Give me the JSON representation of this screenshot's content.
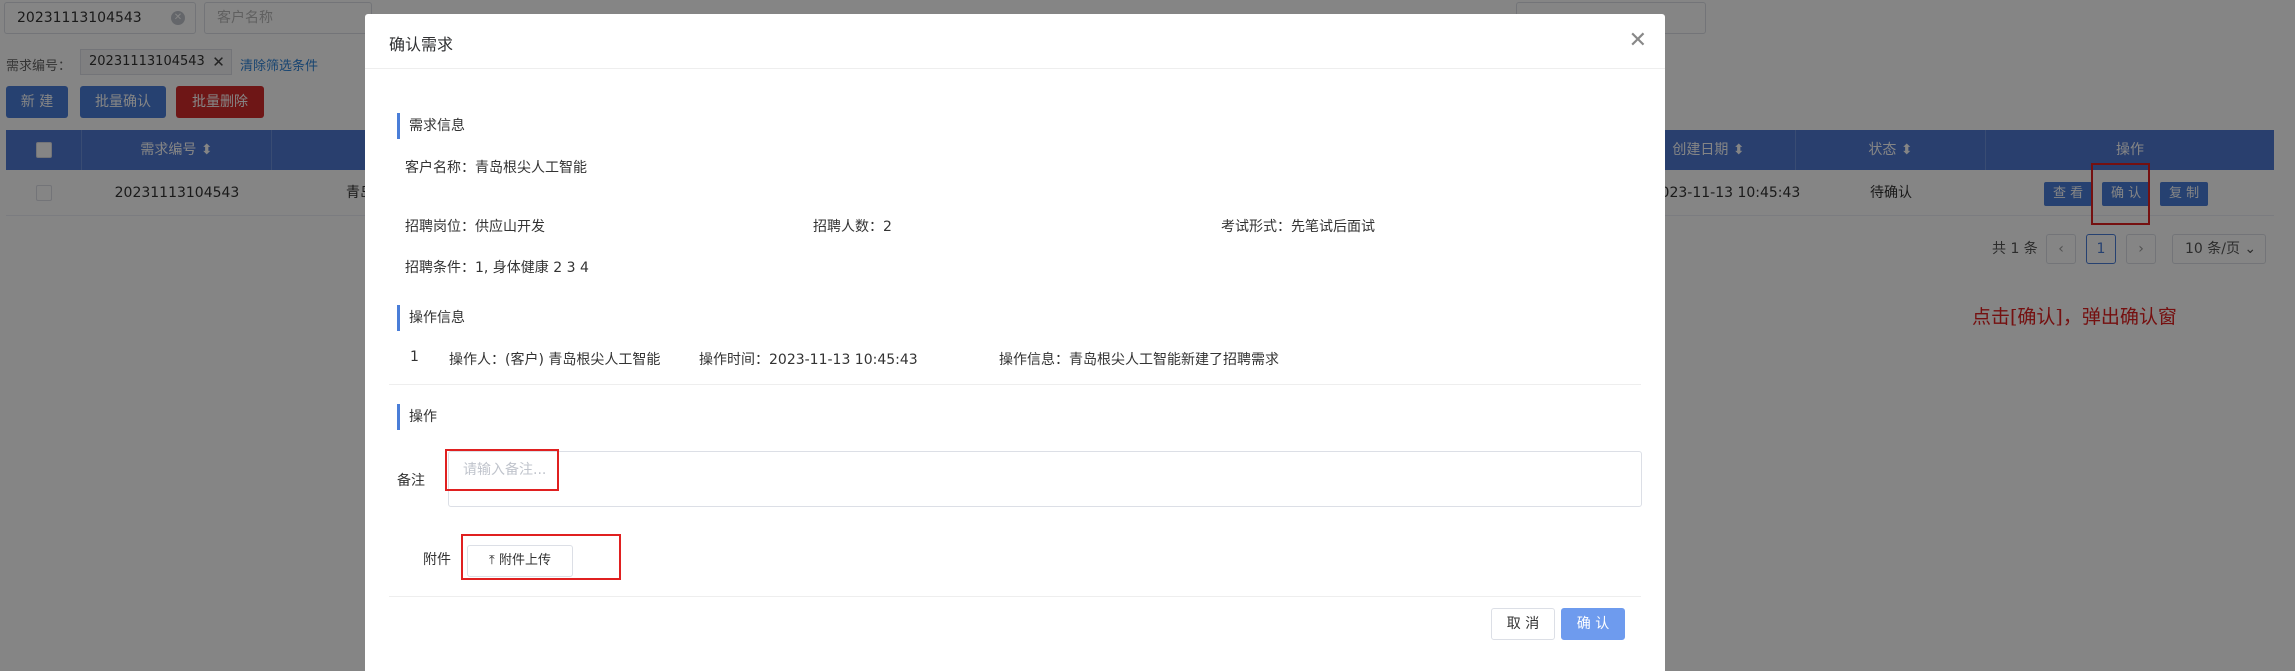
{
  "filters": {
    "req_no_value": "20231113104543",
    "customer_placeholder": "客户名称"
  },
  "conditions": {
    "label": "需求编号：",
    "tag": "20231113104543",
    "tag_close": "✕",
    "clear_link": "清除筛选条件"
  },
  "toolbar": {
    "new_label": "新 建",
    "batch_confirm_label": "批量确认",
    "batch_delete_label": "批量删除"
  },
  "table": {
    "headers": {
      "req_no": "需求编号 ⬍",
      "created": "创建日期 ⬍",
      "status": "状态 ⬍",
      "ops": "操作"
    },
    "row": {
      "req_no": "20231113104543",
      "customer_partial": "青岛",
      "created": "2023-11-13 10:45:43",
      "status": "待确认",
      "view": "查 看",
      "confirm": "确 认",
      "copy": "复 制"
    }
  },
  "pagination": {
    "total": "共 1 条",
    "prev": "‹",
    "page": "1",
    "next": "›",
    "size": "10 条/页 ⌄"
  },
  "annotation": "点击[确认]，弹出确认窗",
  "modal": {
    "title": "确认需求",
    "close": "✕",
    "sections": {
      "req_info": "需求信息",
      "op_info": "操作信息",
      "ops": "操作"
    },
    "req": {
      "customer": "客户名称：青岛根尖人工智能",
      "position": "招聘岗位：供应山开发",
      "headcount": "招聘人数：2",
      "exam": "考试形式：先笔试后面试",
      "conditions": "招聘条件：1, 身体健康 2 3 4"
    },
    "log": {
      "index": "1",
      "operator": "操作人：(客户) 青岛根尖人工智能",
      "time": "操作时间：2023-11-13 10:45:43",
      "info": "操作信息：青岛根尖人工智能新建了招聘需求"
    },
    "form": {
      "remark_label": "备注",
      "remark_placeholder": "请输入备注...",
      "attach_label": "附件",
      "upload_label": "附件上传"
    },
    "footer": {
      "cancel": "取 消",
      "ok": "确 认"
    }
  }
}
